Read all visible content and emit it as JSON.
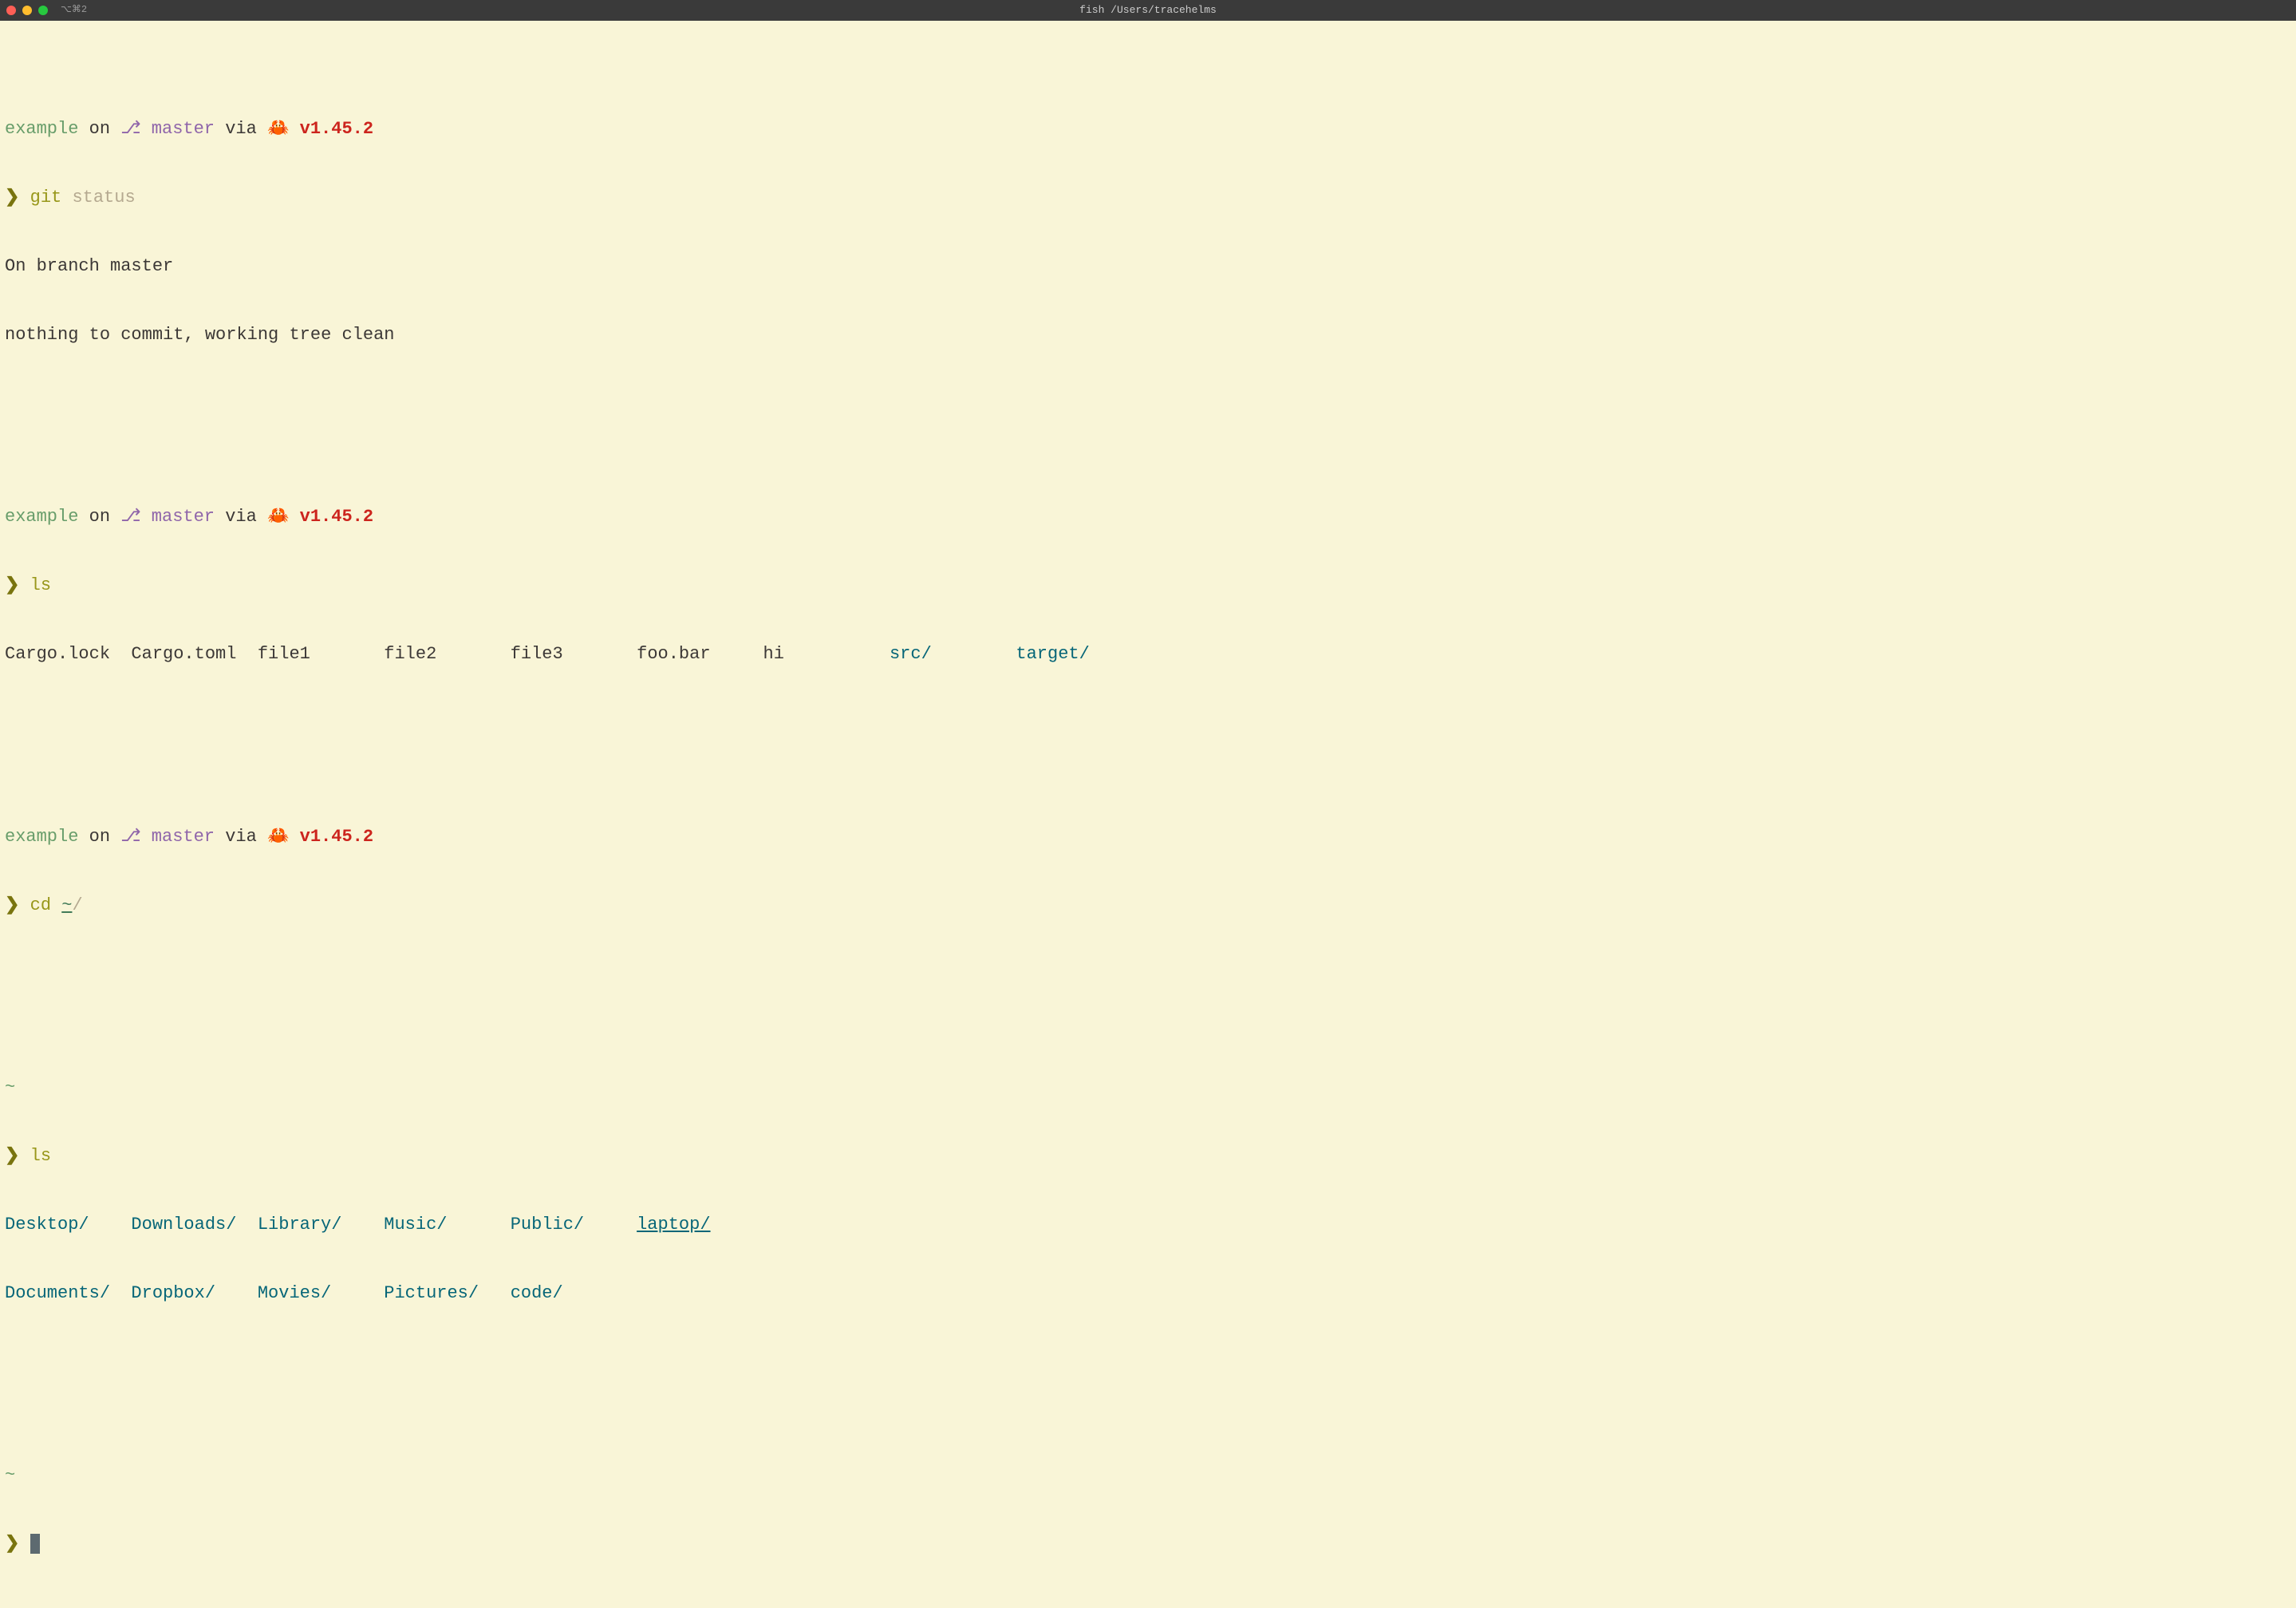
{
  "titlebar": {
    "tab": "⌥⌘2",
    "title": "fish /Users/tracehelms"
  },
  "prompt": {
    "dir": "example",
    "on": " on ",
    "branch_icon": "⎇",
    "branch": " master",
    "via": " via ",
    "crab": "🦀",
    "version": " v1.45.2",
    "arrow": "❯ ",
    "home": "~"
  },
  "cmd1": {
    "git": "git ",
    "status_suggest": "status"
  },
  "out1": {
    "l1": "On branch master",
    "l2": "nothing to commit, working tree clean"
  },
  "cmd2": {
    "ls": "ls"
  },
  "out2": {
    "files": [
      "Cargo.lock",
      "Cargo.toml",
      "file1",
      "file2",
      "file3",
      "foo.bar",
      "hi"
    ],
    "dirs": [
      "src/",
      "target/"
    ]
  },
  "cmd3": {
    "cd": "cd ",
    "tilde": "~",
    "slash_suggest": "/"
  },
  "cmd4": {
    "ls": "ls"
  },
  "out4": {
    "row1": [
      "Desktop/",
      "Downloads/",
      "Library/",
      "Music/",
      "Public/"
    ],
    "row1_link": "laptop/",
    "row2": [
      "Documents/",
      "Dropbox/",
      "Movies/",
      "Pictures/",
      "code/"
    ]
  }
}
